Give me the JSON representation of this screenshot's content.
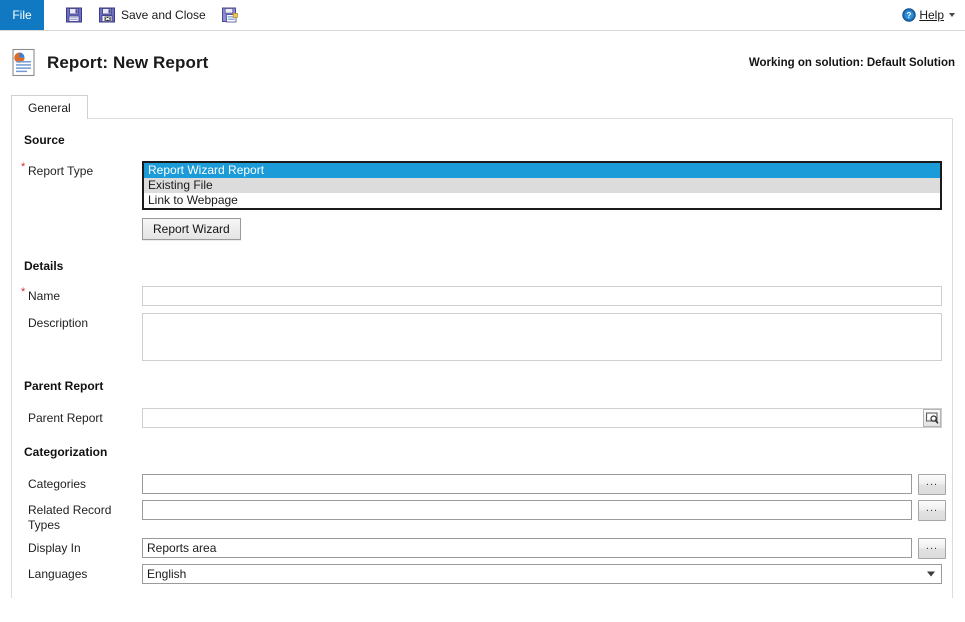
{
  "toolbar": {
    "file_tab": "File",
    "save_icon": "save-floppy-icon",
    "save_and_close_label": "Save and Close",
    "save_and_close_icon": "save-close-floppy-icon",
    "save_as_icon": "save-as-icon",
    "help_label": "Help",
    "help_icon": "help-question-icon",
    "help_caret": "chevron-down-icon"
  },
  "header": {
    "icon": "report-document-icon",
    "title": "Report: New Report",
    "solution_note": "Working on solution: Default Solution"
  },
  "tabs": [
    {
      "label": "General",
      "active": true
    }
  ],
  "sections": {
    "source": {
      "heading": "Source",
      "report_type": {
        "label": "Report Type",
        "required": true,
        "options": [
          {
            "label": "Report Wizard Report",
            "state": "selected"
          },
          {
            "label": "Existing File",
            "state": "alt"
          },
          {
            "label": "Link to Webpage",
            "state": "normal"
          }
        ]
      },
      "wizard_button": "Report Wizard"
    },
    "details": {
      "heading": "Details",
      "name": {
        "label": "Name",
        "required": true,
        "value": "",
        "placeholder": ""
      },
      "description": {
        "label": "Description",
        "value": "",
        "placeholder": ""
      }
    },
    "parent_report": {
      "heading": "Parent Report",
      "field": {
        "label": "Parent Report",
        "value": "",
        "placeholder": "",
        "lookup_icon": "lookup-magnifier-icon"
      }
    },
    "categorization": {
      "heading": "Categorization",
      "categories": {
        "label": "Categories",
        "value": "",
        "browse": "..."
      },
      "related_record_types": {
        "label": "Related Record Types",
        "value": "",
        "browse": "..."
      },
      "display_in": {
        "label": "Display In",
        "value": "Reports area",
        "browse": "..."
      },
      "languages": {
        "label": "Languages",
        "value": "English",
        "caret_icon": "chevron-down-icon",
        "options": [
          "English"
        ]
      }
    }
  },
  "colors": {
    "accent_blue": "#1079c1",
    "select_blue": "#1b9bd8",
    "required_red": "#d4302a",
    "alt_row": "#dcdcdc"
  }
}
